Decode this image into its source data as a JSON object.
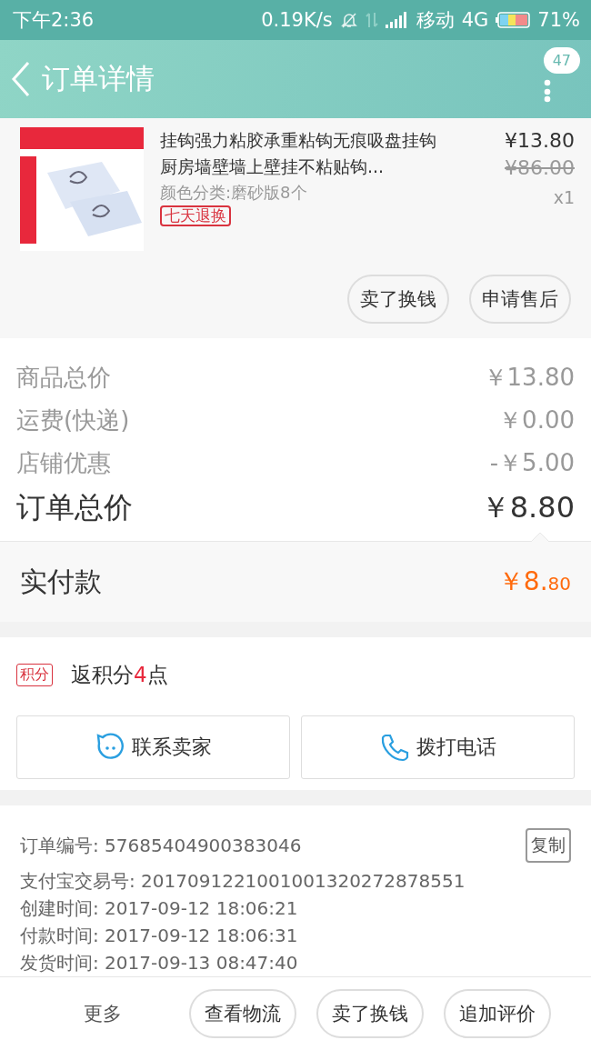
{
  "status_bar": {
    "time": "下午2:36",
    "speed": "0.19K/s",
    "carrier": "移动",
    "network": "4G",
    "battery": "71%"
  },
  "header": {
    "title": "订单详情",
    "badge": "47"
  },
  "product": {
    "title": "挂钩强力粘胶承重粘钩无痕吸盘挂钩厨房墙壁墙上壁挂不粘贴钩...",
    "spec": "颜色分类:磨砂版8个",
    "tag": "七天退换",
    "price": "¥13.80",
    "original_price": "¥86.00",
    "quantity": "x1"
  },
  "product_actions": [
    "卖了换钱",
    "申请售后"
  ],
  "summary": [
    {
      "label": "商品总价",
      "value": "￥13.80",
      "kind": "normal"
    },
    {
      "label": "运费(快递)",
      "value": "￥0.00",
      "kind": "normal"
    },
    {
      "label": "店铺优惠",
      "value": "-￥5.00",
      "kind": "normal"
    },
    {
      "label": "订单总价",
      "value": "￥8.80",
      "kind": "total"
    }
  ],
  "payment": {
    "label": "实付款",
    "amount": "￥8.80"
  },
  "points": {
    "tag": "积分",
    "text": "返积分**4**点"
  },
  "contact_buttons": [
    {
      "label": "联系卖家",
      "kind": "chat"
    },
    {
      "label": "拨打电话",
      "kind": "phone"
    }
  ],
  "order_info": {
    "copy_button": "复制",
    "rows": [
      {
        "label": "订单编号:",
        "value": "57685404900383046"
      },
      {
        "label": "支付宝交易号:",
        "value": "2017091221001001320272878551"
      },
      {
        "label": "创建时间:",
        "value": "2017-09-12 18:06:21"
      },
      {
        "label": "付款时间:",
        "value": "2017-09-12 18:06:31"
      },
      {
        "label": "发货时间:",
        "value": "2017-09-13 08:47:40"
      }
    ]
  },
  "bottom_bar": {
    "more": "更多",
    "buttons": [
      "查看物流",
      "卖了换钱",
      "追加评价"
    ]
  }
}
